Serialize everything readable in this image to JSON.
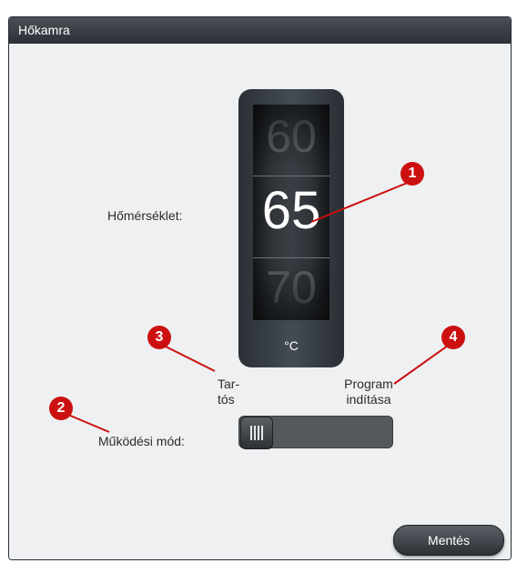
{
  "window": {
    "title": "Hőkamra"
  },
  "temperature": {
    "label": "Hőmérséklet:",
    "prev_value": "60",
    "value": "65",
    "next_value": "70",
    "unit": "°C"
  },
  "mode": {
    "label": "Működési mód:",
    "left_option": "Tar-\ntós",
    "right_option": "Program\nindítása",
    "selected": "Tar-\ntós"
  },
  "save_button": {
    "label": "Mentés"
  },
  "callouts": [
    "1",
    "2",
    "3",
    "4"
  ],
  "colors": {
    "callout": "#cc1010",
    "titlebar": "#2b3036",
    "background": "#eef0f1"
  }
}
